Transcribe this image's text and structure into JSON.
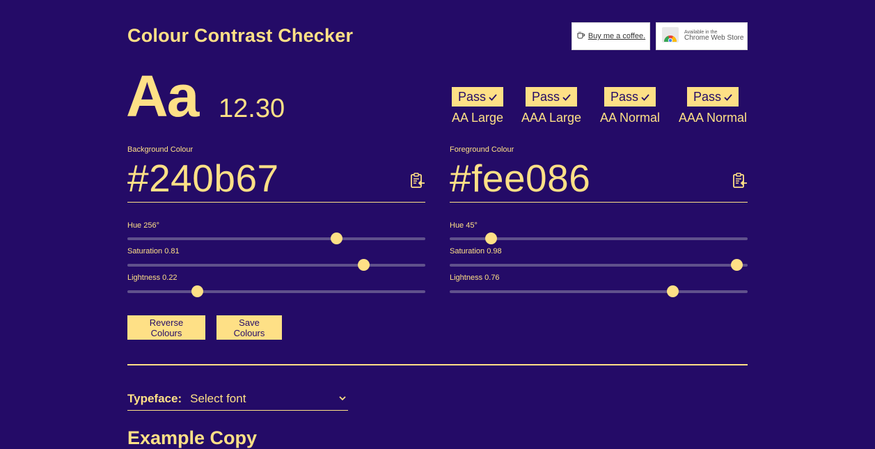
{
  "app": {
    "title": "Colour Contrast Checker"
  },
  "badges": {
    "coffee_label": "Buy me a coffee.",
    "chrome_small": "Available in the",
    "chrome_big": "Chrome Web Store"
  },
  "preview": {
    "sample_text": "Aa",
    "ratio": "12.30"
  },
  "results": [
    {
      "status": "Pass",
      "label": "AA Large"
    },
    {
      "status": "Pass",
      "label": "AAA Large"
    },
    {
      "status": "Pass",
      "label": "AA Normal"
    },
    {
      "status": "Pass",
      "label": "AAA Normal"
    }
  ],
  "background": {
    "label": "Background Colour",
    "hex": "#240b67",
    "hue_label": "Hue 256°",
    "saturation_label": "Saturation 0.81",
    "lightness_label": "Lightness 0.22",
    "hue": 256,
    "saturation": 0.81,
    "lightness": 0.22
  },
  "foreground": {
    "label": "Foreground Colour",
    "hex": "#fee086",
    "hue_label": "Hue 45°",
    "saturation_label": "Saturation 0.98",
    "lightness_label": "Lightness 0.76",
    "hue": 45,
    "saturation": 0.98,
    "lightness": 0.76
  },
  "buttons": {
    "reverse": "Reverse Colours",
    "save": "Save Colours"
  },
  "typeface": {
    "label": "Typeface:",
    "selected": "Select font"
  },
  "example": {
    "heading": "Example Copy"
  },
  "colors": {
    "background": "#240b67",
    "foreground": "#fee086",
    "track": "#60518c"
  },
  "icons": {
    "check": "check-icon",
    "clipboard": "clipboard-paste-icon",
    "chevron": "chevron-down-icon",
    "coffee": "coffee-cup-icon",
    "chrome": "chrome-logo-icon"
  }
}
